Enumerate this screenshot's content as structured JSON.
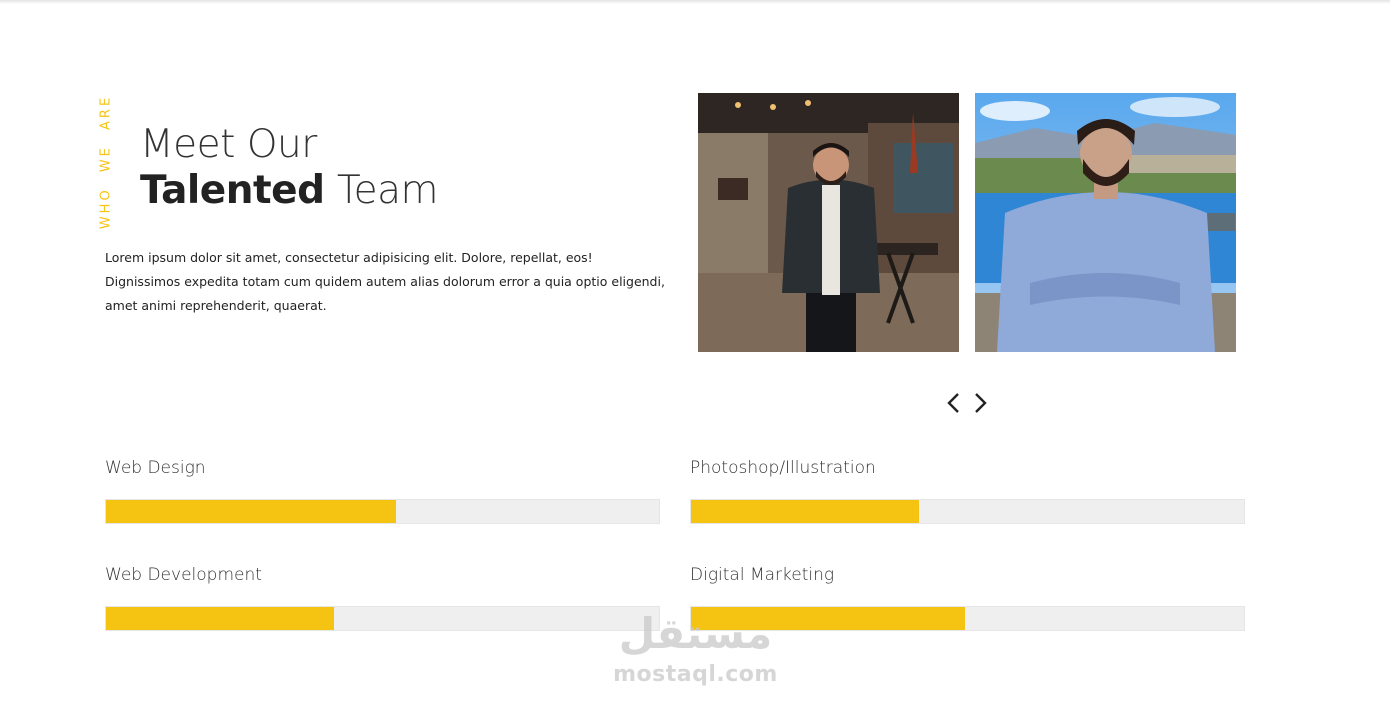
{
  "intro": {
    "vertical_label": "Who we are",
    "heading_line1": "Meet Our",
    "heading_bold": "Talented",
    "heading_light": "Team",
    "description": "Lorem ipsum dolor sit amet, consectetur adipisicing elit. Dolore, repellat, eos! Dignissimos expedita totam cum quidem autem alias dolorum error a quia optio eligendi, amet animi reprehenderit, quaerat."
  },
  "carousel": {
    "photos": [
      {
        "icon": "team-member-photo-indoor"
      },
      {
        "icon": "team-member-photo-outdoor"
      }
    ],
    "prev_icon": "chevron-left-icon",
    "next_icon": "chevron-right-icon"
  },
  "skills": [
    {
      "label": "Web Design",
      "percent": 52.5
    },
    {
      "label": "Photoshop/Illustration",
      "percent": 41.3
    },
    {
      "label": "Web Development",
      "percent": 41.3
    },
    {
      "label": "Digital Marketing",
      "percent": 49.5
    }
  ],
  "colors": {
    "accent": "#f5c413",
    "track": "#efefef",
    "text": "#222222"
  },
  "watermark": {
    "arabic": "مستقل",
    "latin": "mostaql.com"
  }
}
